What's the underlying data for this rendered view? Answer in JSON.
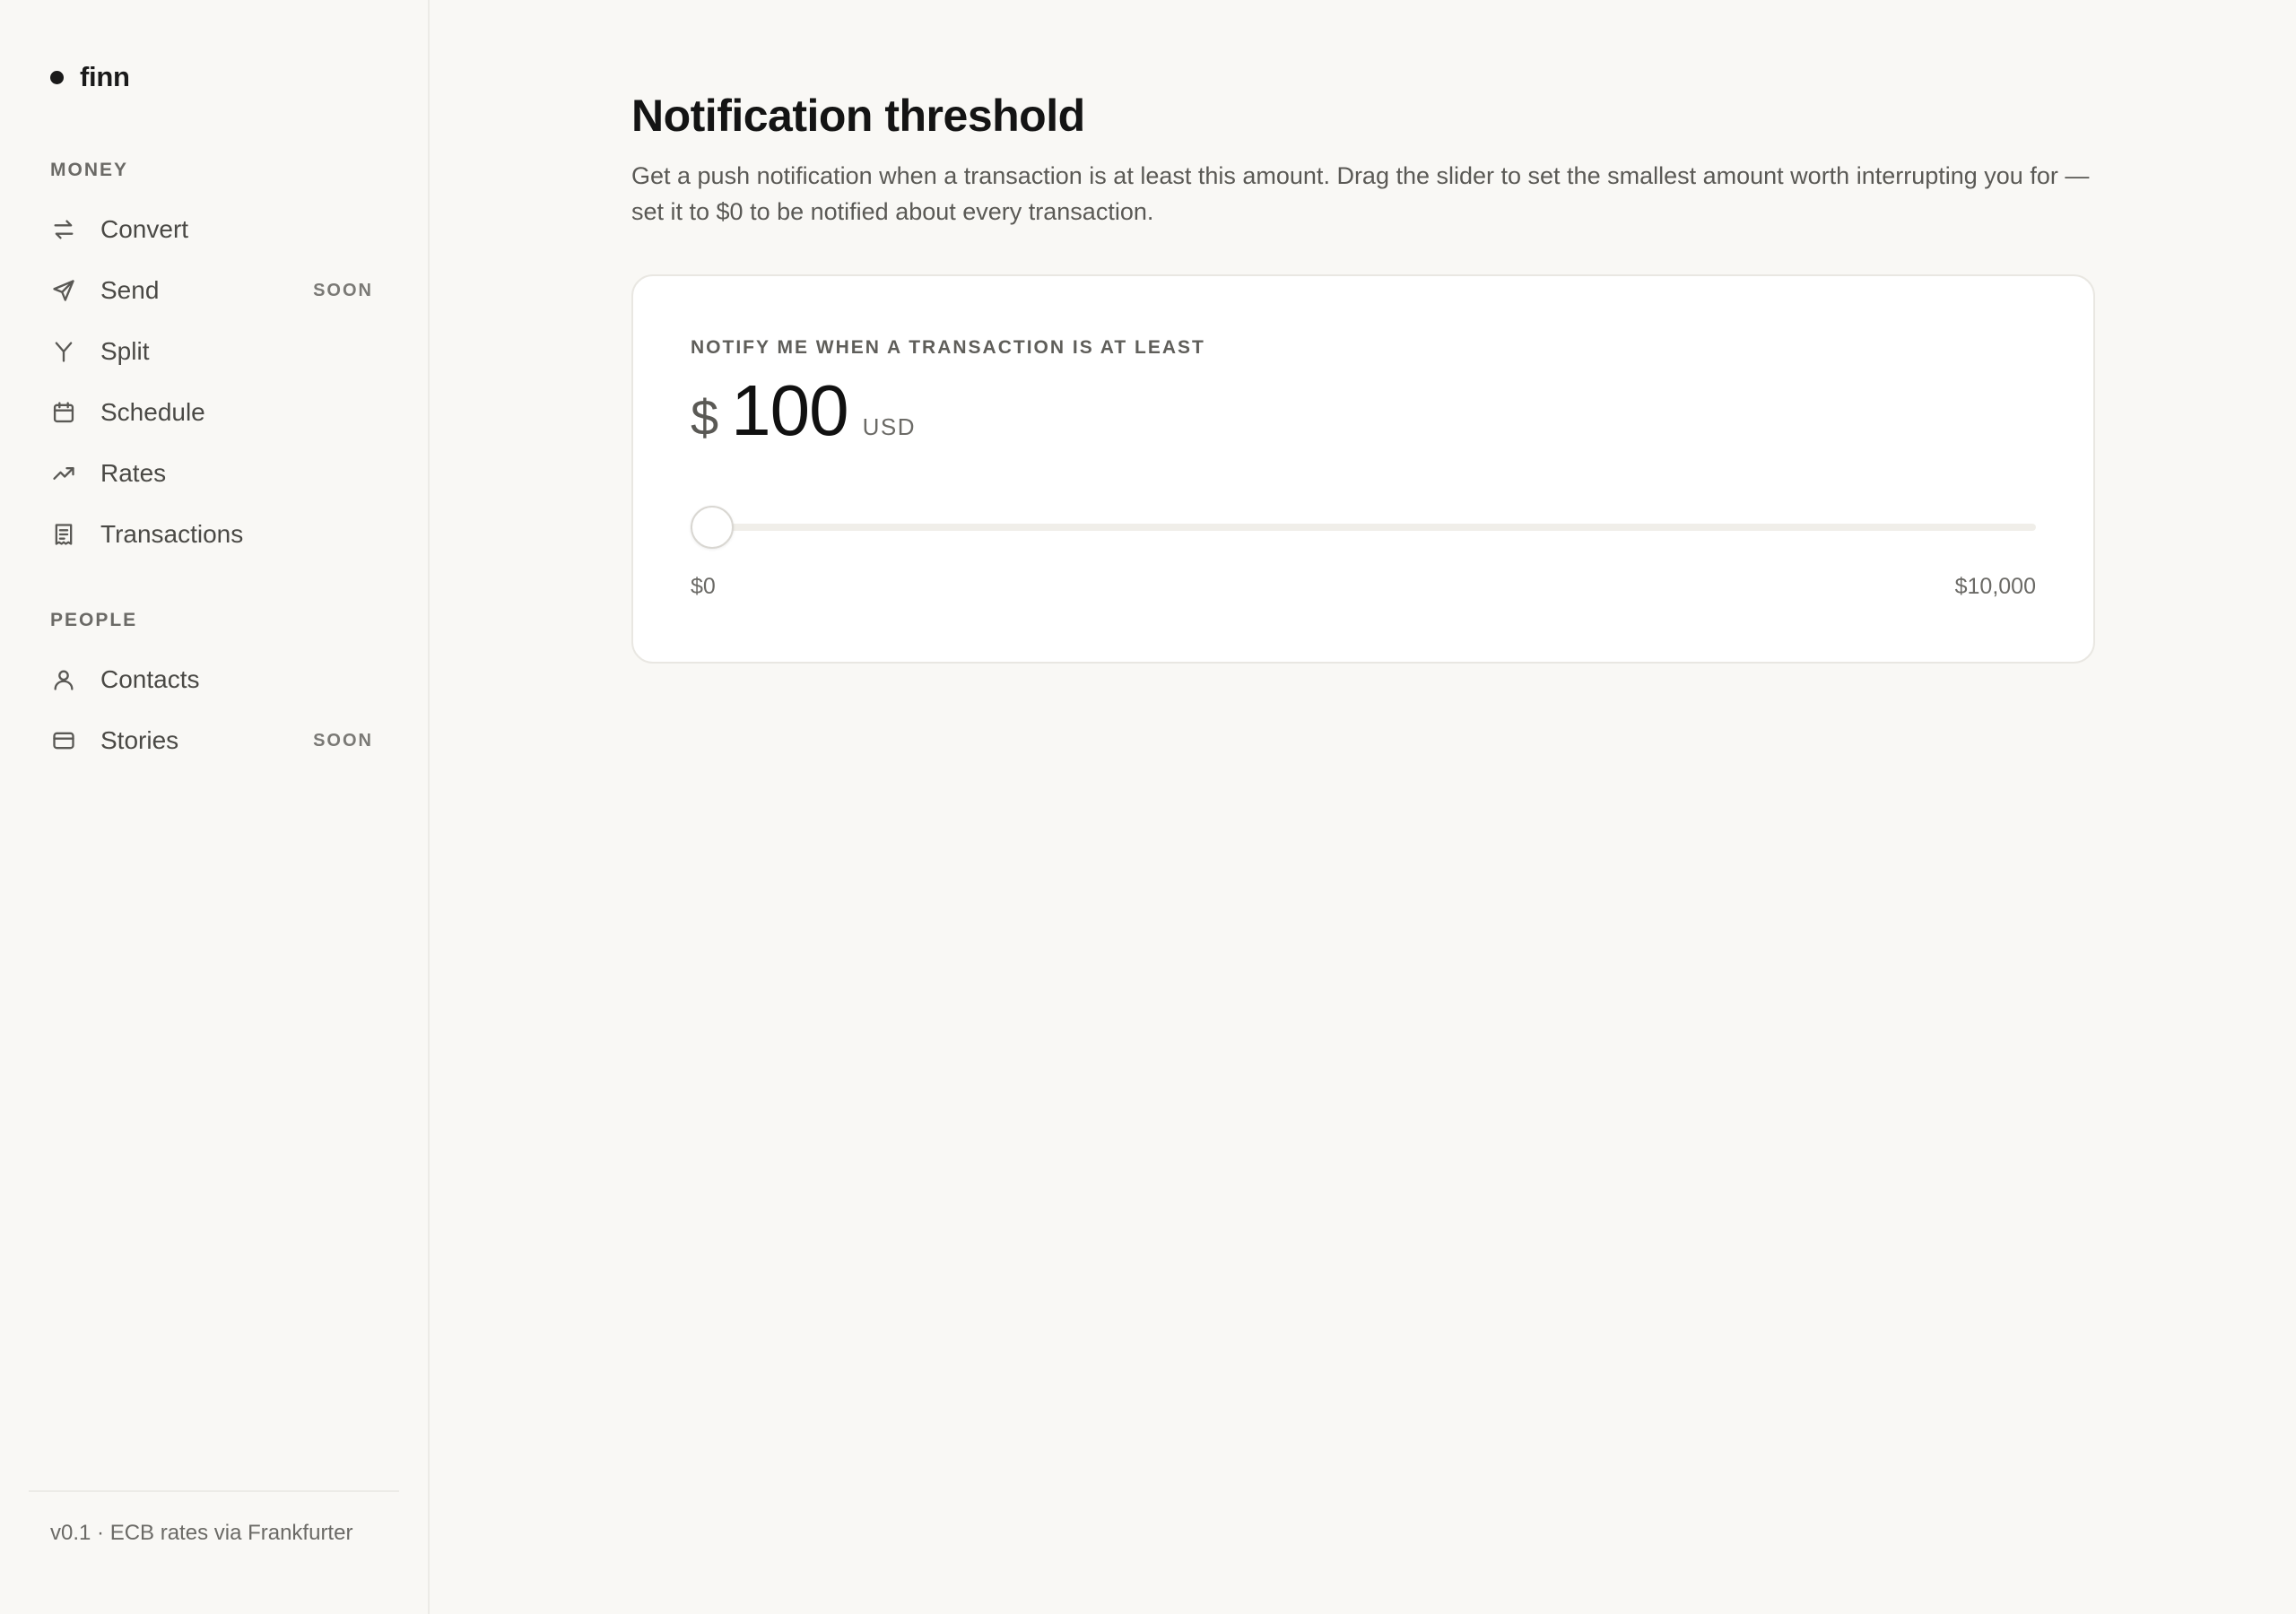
{
  "brand": {
    "name": "finn"
  },
  "sidebar": {
    "sections": [
      {
        "label": "MONEY",
        "items": [
          {
            "label": "Convert",
            "icon": "arrows-swap-icon",
            "badge": ""
          },
          {
            "label": "Send",
            "icon": "paper-plane-icon",
            "badge": "SOON"
          },
          {
            "label": "Split",
            "icon": "split-icon",
            "badge": ""
          },
          {
            "label": "Schedule",
            "icon": "calendar-icon",
            "badge": ""
          },
          {
            "label": "Rates",
            "icon": "trending-up-icon",
            "badge": ""
          },
          {
            "label": "Transactions",
            "icon": "receipt-icon",
            "badge": ""
          }
        ]
      },
      {
        "label": "PEOPLE",
        "items": [
          {
            "label": "Contacts",
            "icon": "user-icon",
            "badge": ""
          },
          {
            "label": "Stories",
            "icon": "card-icon",
            "badge": "SOON"
          }
        ]
      }
    ],
    "footer": "v0.1 · ECB rates via Frankfurter"
  },
  "main": {
    "title": "Notification threshold",
    "description": "Get a push notification when a transaction is at least this amount. Drag the slider to set the smallest amount worth interrupting you for — set it to $0 to be notified about every transaction.",
    "card": {
      "label": "NOTIFY ME WHEN A TRANSACTION IS AT LEAST",
      "currency_symbol": "$",
      "amount": "100",
      "unit": "USD",
      "slider": {
        "value": 100,
        "min": 0,
        "max": 10000,
        "min_label": "$0",
        "max_label": "$10,000"
      }
    }
  }
}
